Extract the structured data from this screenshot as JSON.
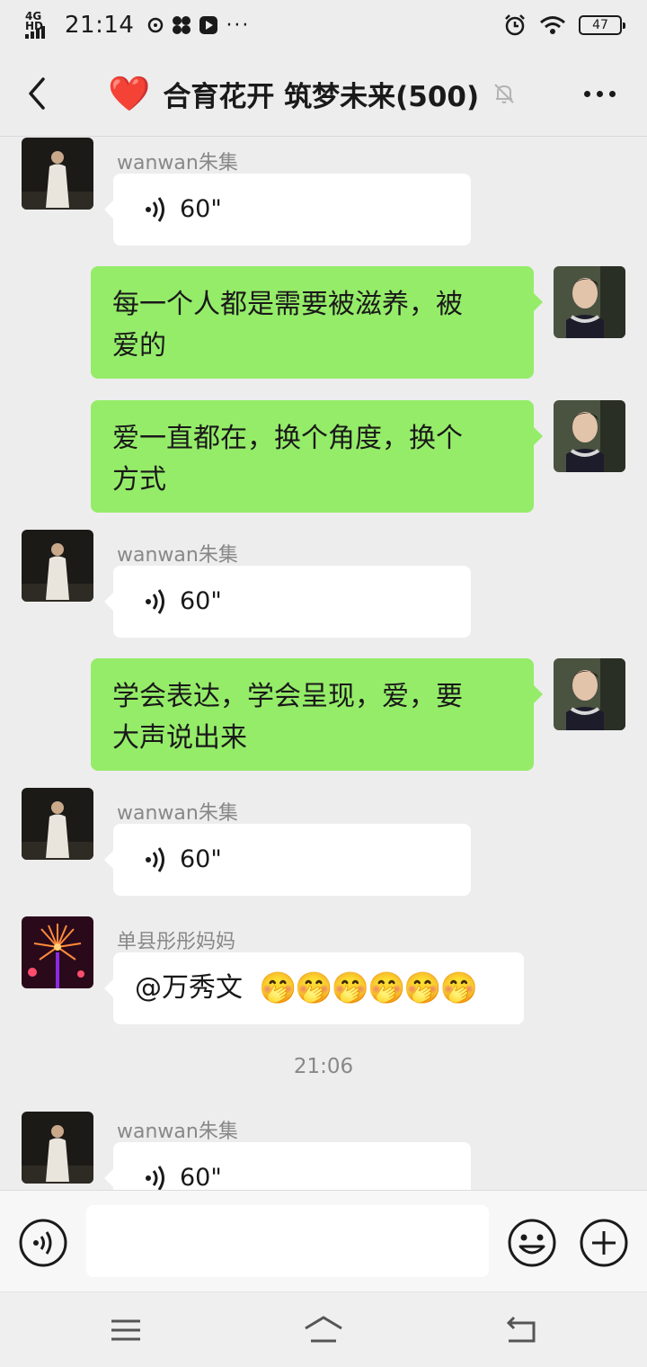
{
  "status_bar": {
    "network": "4G HD",
    "time": "21:14",
    "battery": "47"
  },
  "header": {
    "title": "合育花开 筑梦未来(500)",
    "title_emoji": "❤️"
  },
  "messages": [
    {
      "type": "voice",
      "side": "left",
      "sender": "wanwan朱集",
      "duration": "60\""
    },
    {
      "type": "text",
      "side": "right",
      "lines": [
        "每一个人都是需要被滋养，被",
        "爱的"
      ]
    },
    {
      "type": "text",
      "side": "right",
      "lines": [
        "爱一直都在，换个角度，换个",
        "方式"
      ]
    },
    {
      "type": "voice",
      "side": "left",
      "sender": "wanwan朱集",
      "duration": "60\""
    },
    {
      "type": "text",
      "side": "right",
      "lines": [
        "学会表达，学会呈现，爱，要",
        "大声说出来"
      ]
    },
    {
      "type": "voice",
      "side": "left",
      "sender": "wanwan朱集",
      "duration": "60\""
    },
    {
      "type": "text",
      "side": "left",
      "sender": "单县彤彤妈妈",
      "text": "@万秀文",
      "emojis": "🤭🤭🤭🤭🤭🤭"
    },
    {
      "type": "voice",
      "side": "left",
      "sender": "wanwan朱集",
      "duration": "60\""
    }
  ],
  "timestamp": "21:06",
  "input": {
    "value": "",
    "placeholder": ""
  },
  "colors": {
    "background": "#ededed",
    "green_bubble": "#95ec69",
    "white_bubble": "#ffffff",
    "title_heart": "#e53935"
  }
}
